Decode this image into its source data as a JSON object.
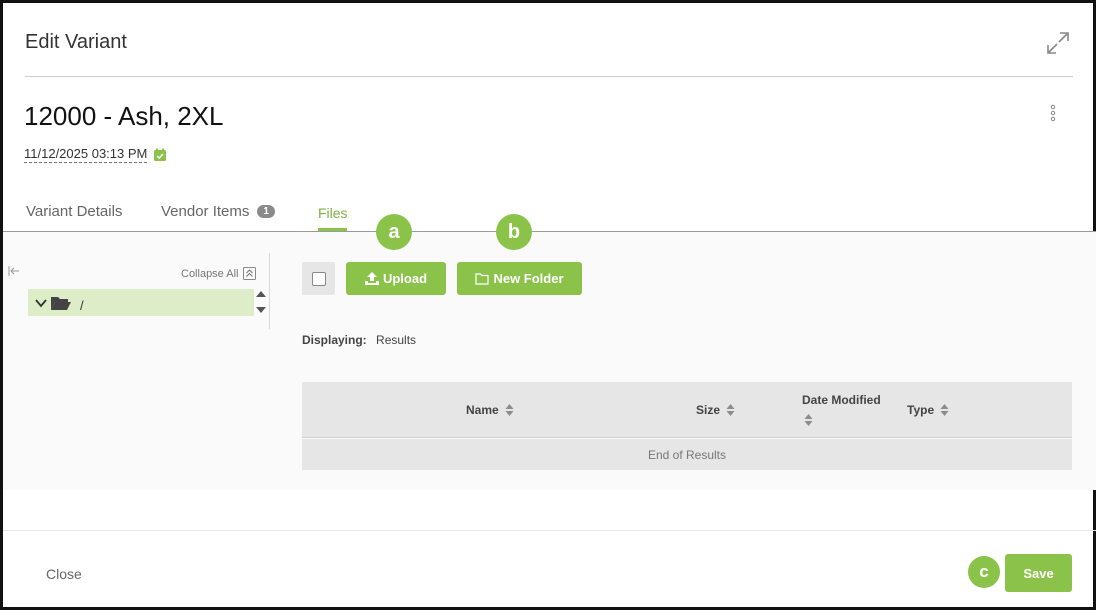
{
  "modal": {
    "title": "Edit Variant",
    "expand_icon": "expand-icon"
  },
  "record": {
    "title": "12000 - Ash, 2XL",
    "date": "11/12/2025 03:13 PM",
    "menu_icon": "kebab-icon"
  },
  "tabs": [
    {
      "label": "Variant Details",
      "active": false
    },
    {
      "label": "Vendor Items",
      "badge": "1",
      "active": false
    },
    {
      "label": "Files",
      "active": true
    }
  ],
  "tree": {
    "collapse_all_label": "Collapse All",
    "root_label": "/"
  },
  "toolbar": {
    "upload_label": "Upload",
    "new_folder_label": "New Folder"
  },
  "markers": {
    "a": "a",
    "b": "b",
    "c": "c"
  },
  "displaying": {
    "label": "Displaying:",
    "value": "Results"
  },
  "grid": {
    "columns": [
      "Name",
      "Size",
      "Date Modified",
      "Type"
    ],
    "footer": "End of Results"
  },
  "footer": {
    "close_label": "Close",
    "save_label": "Save"
  },
  "colors": {
    "accent": "#8bc34a",
    "tree_selected": "#dcedc8",
    "grid_bg": "#e6e6e6"
  }
}
